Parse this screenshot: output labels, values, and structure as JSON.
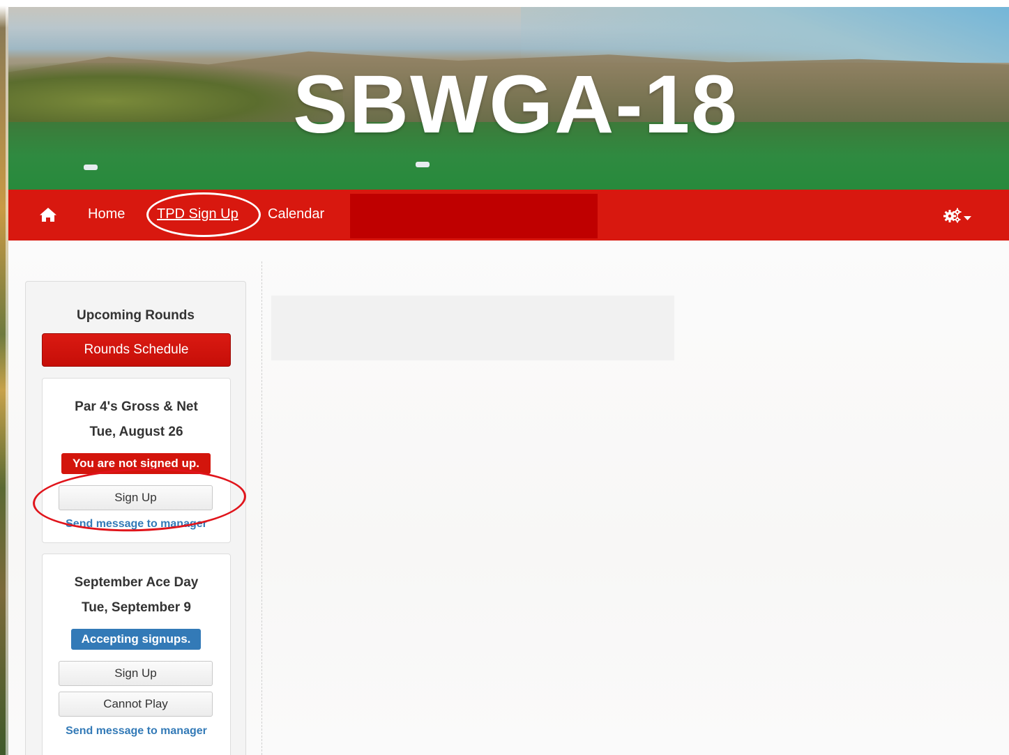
{
  "banner": {
    "title": "SBWGA-18"
  },
  "nav": {
    "home": "Home",
    "signup": "TPD Sign Up",
    "calendar": "Calendar"
  },
  "sidebar": {
    "title": "Upcoming Rounds",
    "schedule_button": "Rounds Schedule",
    "rounds": [
      {
        "name": "Par 4's Gross & Net",
        "date": "Tue, August 26",
        "status": "You are not signed up.",
        "status_color": "#d3150c",
        "signup_label": "Sign Up",
        "message_label": "Send message to manager"
      },
      {
        "name": "September Ace Day",
        "date": "Tue, September 9",
        "status": "Accepting signups.",
        "status_color": "#337ab7",
        "signup_label": "Sign Up",
        "cannot_play_label": "Cannot Play",
        "message_label": "Send message to manager"
      }
    ]
  },
  "colors": {
    "navbar": "#d8180f",
    "accent_red": "#d3150c",
    "link_blue": "#337ab7",
    "annotation_red": "#e0141b"
  },
  "icons": {
    "home": "home-icon",
    "settings": "gears-dropdown-icon"
  }
}
